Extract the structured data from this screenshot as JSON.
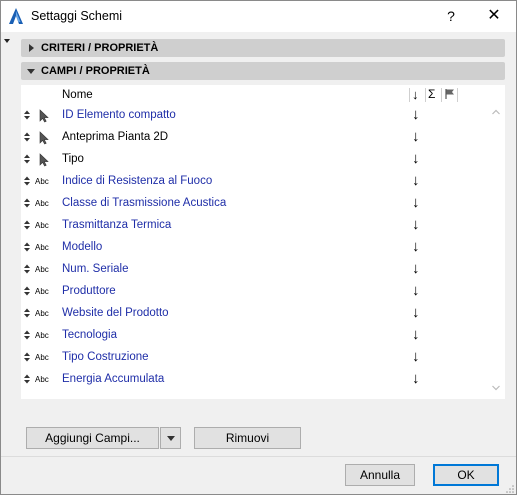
{
  "window": {
    "title": "Settaggi Schemi",
    "help_label": "?",
    "close_label": "✕"
  },
  "sections": {
    "criteri_label": "CRITERI /  PROPRIETÀ",
    "campi_label": "CAMPI /  PROPRIETÀ"
  },
  "table": {
    "header_name": "Nome",
    "header_sort": "↓",
    "header_sum": "Σ",
    "rows": [
      {
        "icon": "cursor-icon",
        "type_label": "",
        "name": "ID Elemento compatto",
        "sort": "↓",
        "blue": true
      },
      {
        "icon": "cursor-icon",
        "type_label": "",
        "name": "Anteprima Pianta 2D",
        "sort": "↓",
        "blue": false
      },
      {
        "icon": "cursor-icon",
        "type_label": "",
        "name": "Tipo",
        "sort": "↓",
        "blue": false
      },
      {
        "icon": "text-type-icon",
        "type_label": "Abc",
        "name": "Indice di Resistenza al Fuoco",
        "sort": "↓",
        "blue": true
      },
      {
        "icon": "text-type-icon",
        "type_label": "Abc",
        "name": "Classe di Trasmissione Acustica",
        "sort": "↓",
        "blue": true
      },
      {
        "icon": "text-type-icon",
        "type_label": "Abc",
        "name": "Trasmittanza Termica",
        "sort": "↓",
        "blue": true
      },
      {
        "icon": "text-type-icon",
        "type_label": "Abc",
        "name": "Modello",
        "sort": "↓",
        "blue": true
      },
      {
        "icon": "text-type-icon",
        "type_label": "Abc",
        "name": "Num. Seriale",
        "sort": "↓",
        "blue": true
      },
      {
        "icon": "text-type-icon",
        "type_label": "Abc",
        "name": "Produttore",
        "sort": "↓",
        "blue": true
      },
      {
        "icon": "text-type-icon",
        "type_label": "Abc",
        "name": "Website del Prodotto",
        "sort": "↓",
        "blue": true
      },
      {
        "icon": "text-type-icon",
        "type_label": "Abc",
        "name": "Tecnologia",
        "sort": "↓",
        "blue": true
      },
      {
        "icon": "text-type-icon",
        "type_label": "Abc",
        "name": "Tipo Costruzione",
        "sort": "↓",
        "blue": true
      },
      {
        "icon": "text-type-icon",
        "type_label": "Abc",
        "name": "Energia Accumulata",
        "sort": "↓",
        "blue": true
      }
    ]
  },
  "buttons": {
    "add_fields": "Aggiungi Campi...",
    "remove": "Rimuovi",
    "cancel": "Annulla",
    "ok": "OK"
  },
  "colors": {
    "link_text": "#1f2ea8",
    "section_bg": "#cfcfcf",
    "dialog_bg": "#f0f0f0",
    "ok_border": "#0078d7"
  }
}
